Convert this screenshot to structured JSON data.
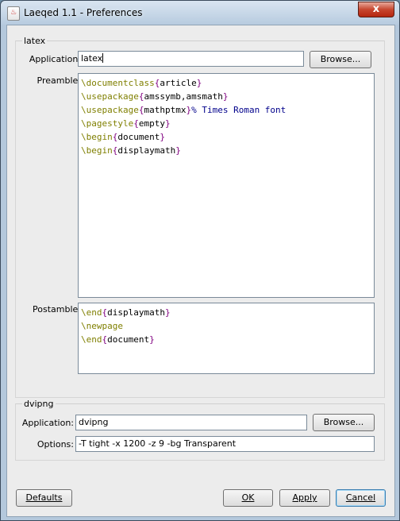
{
  "window": {
    "title": "Laeqed 1.1 - Preferences",
    "close_glyph": "x"
  },
  "latex": {
    "group_title": "latex",
    "application_label": "Application:",
    "application_value": "latex",
    "browse_label": "Browse...",
    "preamble_label": "Preamble:",
    "preamble_lines": [
      [
        {
          "t": "cmd",
          "v": "\\documentclass"
        },
        {
          "t": "brace",
          "v": "{"
        },
        {
          "t": "arg",
          "v": "article"
        },
        {
          "t": "brace",
          "v": "}"
        }
      ],
      [
        {
          "t": "cmd",
          "v": "\\usepackage"
        },
        {
          "t": "brace",
          "v": "{"
        },
        {
          "t": "arg",
          "v": "amssymb,amsmath"
        },
        {
          "t": "brace",
          "v": "}"
        }
      ],
      [
        {
          "t": "cmd",
          "v": "\\usepackage"
        },
        {
          "t": "brace",
          "v": "{"
        },
        {
          "t": "arg",
          "v": "mathptmx"
        },
        {
          "t": "brace",
          "v": "}"
        },
        {
          "t": "comment",
          "v": "% Times Roman font"
        }
      ],
      [
        {
          "t": "cmd",
          "v": "\\pagestyle"
        },
        {
          "t": "brace",
          "v": "{"
        },
        {
          "t": "arg",
          "v": "empty"
        },
        {
          "t": "brace",
          "v": "}"
        }
      ],
      [
        {
          "t": "cmd",
          "v": "\\begin"
        },
        {
          "t": "brace",
          "v": "{"
        },
        {
          "t": "arg",
          "v": "document"
        },
        {
          "t": "brace",
          "v": "}"
        }
      ],
      [
        {
          "t": "cmd",
          "v": "\\begin"
        },
        {
          "t": "brace",
          "v": "{"
        },
        {
          "t": "arg",
          "v": "displaymath"
        },
        {
          "t": "brace",
          "v": "}"
        }
      ]
    ],
    "postamble_label": "Postamble:",
    "postamble_lines": [
      [
        {
          "t": "cmd",
          "v": "\\end"
        },
        {
          "t": "brace",
          "v": "{"
        },
        {
          "t": "arg",
          "v": "displaymath"
        },
        {
          "t": "brace",
          "v": "}"
        }
      ],
      [
        {
          "t": "cmd",
          "v": "\\newpage"
        }
      ],
      [
        {
          "t": "cmd",
          "v": "\\end"
        },
        {
          "t": "brace",
          "v": "{"
        },
        {
          "t": "arg",
          "v": "document"
        },
        {
          "t": "brace",
          "v": "}"
        }
      ]
    ]
  },
  "dvipng": {
    "group_title": "dvipng",
    "application_label": "Application:",
    "application_value": "dvipng",
    "browse_label": "Browse...",
    "options_label": "Options:",
    "options_value": "-T tight -x 1200 -z 9 -bg Transparent"
  },
  "buttons": {
    "defaults": "Defaults",
    "ok": "OK",
    "apply": "Apply",
    "cancel": "Cancel"
  },
  "colors": {
    "command": "#7f7f00",
    "brace": "#800080",
    "comment": "#00008b"
  }
}
